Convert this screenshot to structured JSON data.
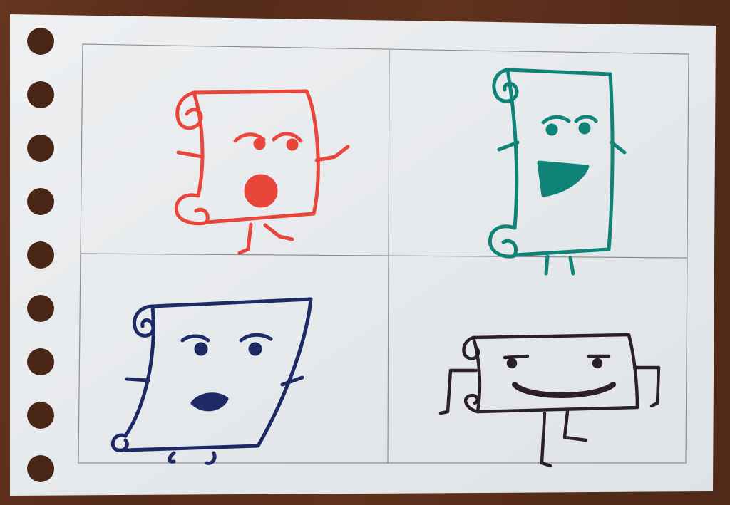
{
  "scene": {
    "description_visible_text": "",
    "colors": {
      "table_wood": "#5a2f1c",
      "paper": "#e9ecee",
      "grid_line": "#8d8f93",
      "hole": "#4a2616",
      "red_marker": "#e8463a",
      "teal_marker": "#0f8378",
      "navy_marker": "#1e2a66",
      "dark_marker": "#2a1f2a"
    },
    "panels": [
      {
        "character": "red-scroll",
        "expression": "surprised",
        "color_key": "red_marker"
      },
      {
        "character": "teal-scroll",
        "expression": "laughing",
        "color_key": "teal_marker"
      },
      {
        "character": "navy-scroll",
        "expression": "surprised",
        "color_key": "navy_marker"
      },
      {
        "character": "dark-scroll",
        "expression": "smiling",
        "color_key": "dark_marker"
      }
    ],
    "binder_hole_count": 9,
    "grid": {
      "rows": 2,
      "columns": 2
    }
  }
}
